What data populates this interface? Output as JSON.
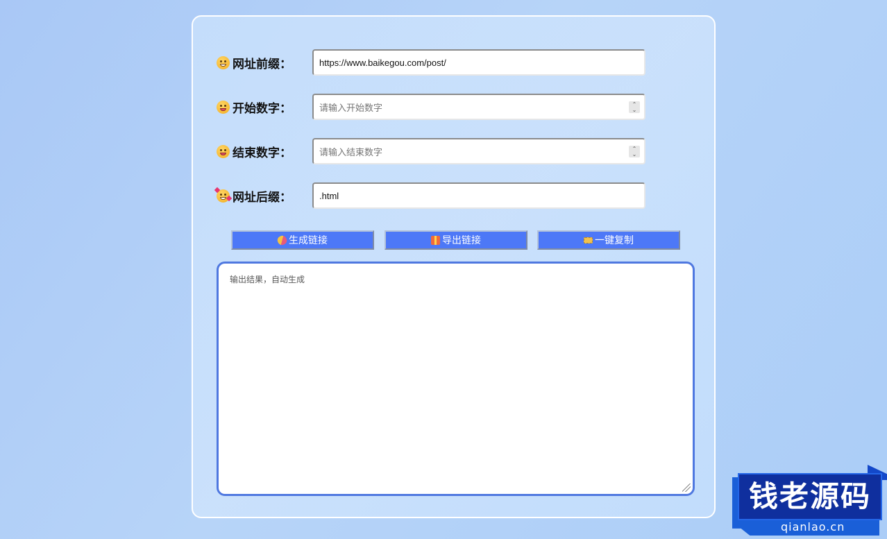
{
  "form": {
    "prefix_label": "网址前缀：",
    "prefix_value": "https://www.baikegou.com/post/",
    "start_label": "开始数字：",
    "start_placeholder": "请输入开始数字",
    "end_label": "结束数字：",
    "end_placeholder": "请输入结束数字",
    "suffix_label": "网址后缀：",
    "suffix_value": ".html"
  },
  "buttons": {
    "generate": "生成链接",
    "export": "导出链接",
    "copy": "一键复制"
  },
  "output": {
    "placeholder": "输出结果，自动生成"
  },
  "watermark": {
    "title": "钱老源码",
    "site": "qianlao.cn"
  },
  "icons": {
    "prefix": "grinning-face-icon",
    "start": "tongue-face-icon",
    "end": "savoring-face-icon",
    "suffix": "smiling-face-with-hearts-icon",
    "generate": "pill-icon",
    "export": "gift-icon",
    "copy": "ticket-icon"
  },
  "colors": {
    "button": "#4d78f7",
    "textarea_border": "#4f78e0",
    "watermark": "#0f2f9e"
  }
}
